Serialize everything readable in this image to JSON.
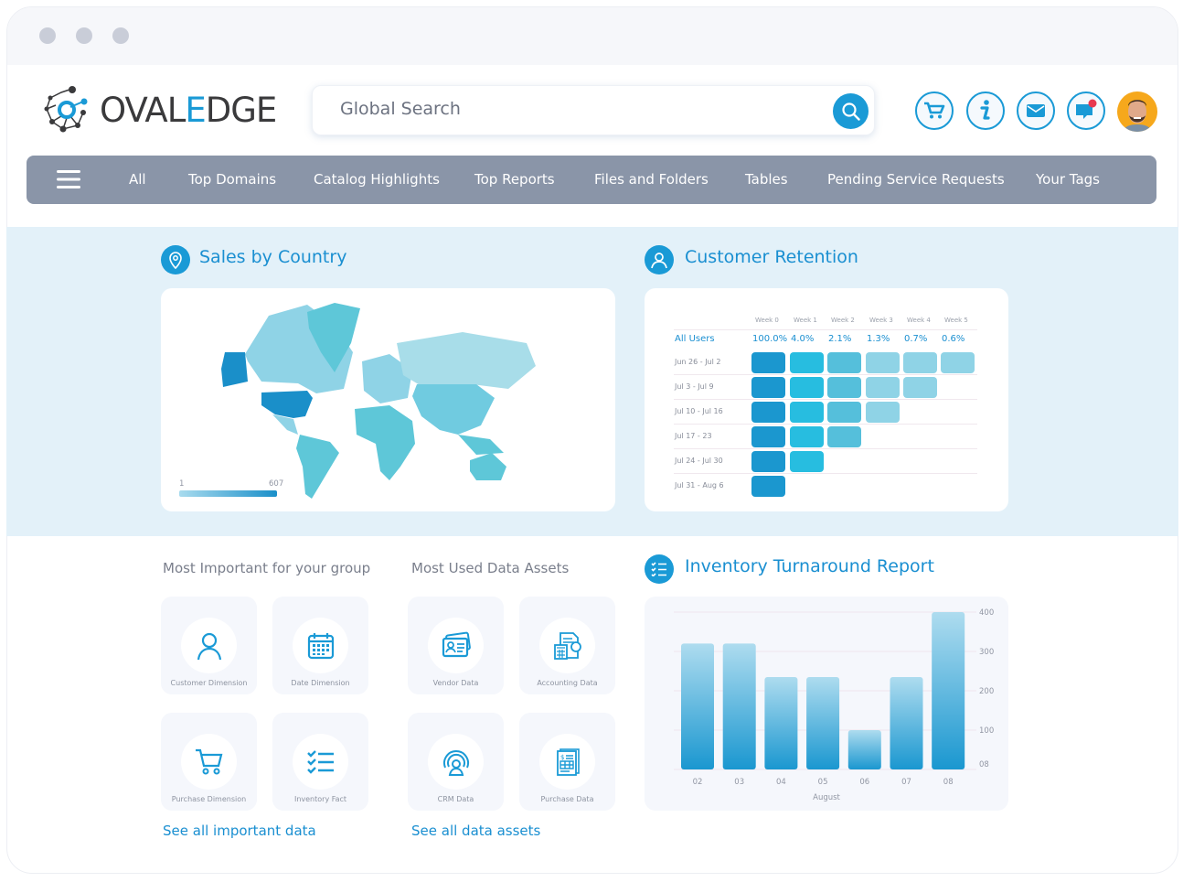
{
  "brand": {
    "name_part1": "OVAL",
    "name_accent": "E",
    "name_part2": "DGE",
    "accent_color": "#1a9ad6"
  },
  "search": {
    "placeholder": "Global Search",
    "value": ""
  },
  "header_icons": [
    "cart-icon",
    "info-icon",
    "mail-icon",
    "chat-notification-icon",
    "user-avatar"
  ],
  "nav": {
    "items": [
      "All",
      "Top Domains",
      "Catalog Highlights",
      "Top Reports",
      "Files and Folders",
      "Tables",
      "Pending Service Requests",
      "Your Tags"
    ]
  },
  "sales": {
    "title": "Sales by Country",
    "legend_min": "1",
    "legend_max": "607"
  },
  "retention": {
    "title": "Customer Retention",
    "weeks": [
      "Week 0",
      "Week 1",
      "Week 2",
      "Week 3",
      "Week 4",
      "Week 5"
    ],
    "all_label": "All Users",
    "all_values": [
      "100.0%",
      "4.0%",
      "2.1%",
      "1.3%",
      "0.7%",
      "0.6%"
    ],
    "rows": [
      {
        "label": "Jun 26 - Jul 2",
        "cells": 6
      },
      {
        "label": "Jul 3 - Jul 9",
        "cells": 5
      },
      {
        "label": "Jul 10 - Jul 16",
        "cells": 4
      },
      {
        "label": "Jul 17 - 23",
        "cells": 3
      },
      {
        "label": "Jul 24 - Jul 30",
        "cells": 2
      },
      {
        "label": "Jul 31 - Aug 6",
        "cells": 1
      }
    ],
    "colors": [
      "#1b97cf",
      "#27bde0",
      "#55bfdb",
      "#8fd3e6",
      "#8fd3e6",
      "#8fd3e6"
    ]
  },
  "important": {
    "heading": "Most Important for your group",
    "items": [
      {
        "label": "Customer Dimension",
        "icon": "user-icon"
      },
      {
        "label": "Date Dimension",
        "icon": "calendar-icon"
      },
      {
        "label": "Purchase Dimension",
        "icon": "cart-icon"
      },
      {
        "label": "Inventory Fact",
        "icon": "checklist-icon"
      }
    ],
    "link": "See all important data"
  },
  "used": {
    "heading": "Most Used Data Assets",
    "items": [
      {
        "label": "Vendor Data",
        "icon": "id-card-icon"
      },
      {
        "label": "Accounting Data",
        "icon": "accounting-icon"
      },
      {
        "label": "CRM Data",
        "icon": "crm-icon"
      },
      {
        "label": "Purchase Data",
        "icon": "invoice-icon"
      }
    ],
    "link": "See all data assets"
  },
  "inventory": {
    "title": "Inventory Turnaround Report"
  },
  "chart_data": {
    "type": "bar",
    "categories": [
      "02",
      "03",
      "04",
      "05",
      "06",
      "07",
      "08"
    ],
    "values": [
      320,
      320,
      235,
      235,
      100,
      235,
      400
    ],
    "xlabel": "August",
    "ylabel": "",
    "ylim": [
      0,
      400
    ],
    "yticks": [
      {
        "v": 0,
        "label": "08"
      },
      {
        "v": 100,
        "label": "100"
      },
      {
        "v": 200,
        "label": "200"
      },
      {
        "v": 300,
        "label": "300"
      },
      {
        "v": 400,
        "label": "400"
      }
    ],
    "grid": true,
    "y_axis_side": "right",
    "bar_gradient": [
      "#aedcef",
      "#1a97d0"
    ]
  }
}
